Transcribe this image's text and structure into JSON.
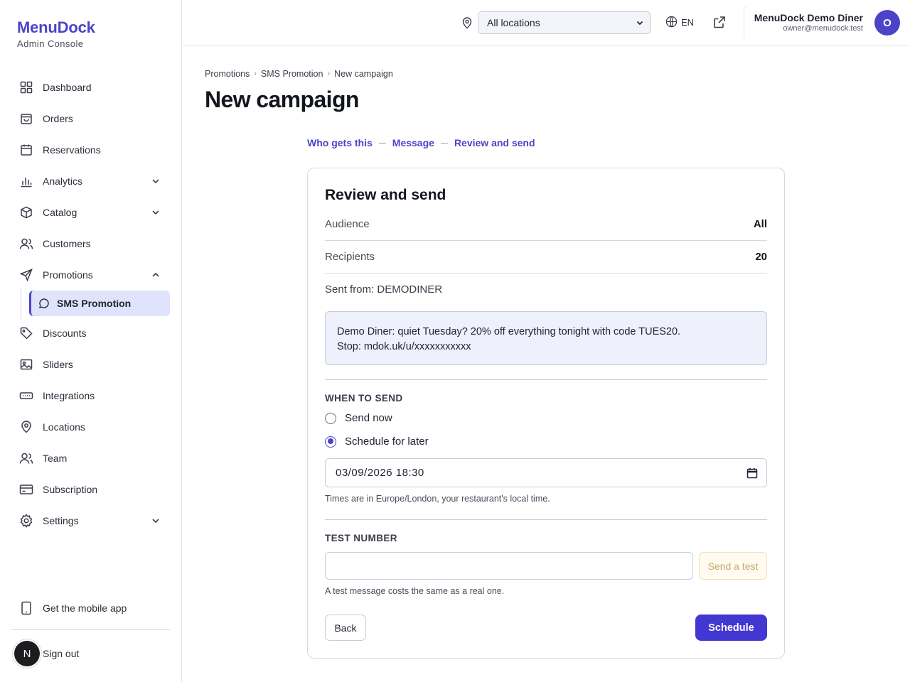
{
  "sidebar": {
    "brand_name": "MenuDock",
    "brand_sub": "Admin Console",
    "items": [
      {
        "label": "Dashboard",
        "icon": "grid-icon"
      },
      {
        "label": "Orders",
        "icon": "shopping-bag-icon"
      },
      {
        "label": "Reservations",
        "icon": "calendar-icon"
      },
      {
        "label": "Analytics",
        "icon": "bar-chart-icon",
        "expandable": true
      },
      {
        "label": "Catalog",
        "icon": "box-icon",
        "expandable": true
      },
      {
        "label": "Customers",
        "icon": "users-icon"
      },
      {
        "label": "Promotions",
        "icon": "send-icon",
        "expanded": true
      },
      {
        "label": "Discounts",
        "icon": "tag-icon"
      },
      {
        "label": "Sliders",
        "icon": "image-icon"
      },
      {
        "label": "Integrations",
        "icon": "plug-icon"
      },
      {
        "label": "Locations",
        "icon": "map-pin-icon"
      },
      {
        "label": "Team",
        "icon": "team-icon"
      },
      {
        "label": "Subscription",
        "icon": "credit-card-icon"
      },
      {
        "label": "Settings",
        "icon": "gear-icon",
        "expandable": true
      }
    ],
    "sub_item": {
      "label": "SMS Promotion",
      "icon": "message-circle-icon"
    },
    "mobile_app": "Get the mobile app",
    "sign_out": "Sign out",
    "badge_letter": "N"
  },
  "topbar": {
    "location_select": "All locations",
    "language": "EN",
    "user_name": "MenuDock Demo Diner",
    "user_email": "owner@menudock.test",
    "avatar_letter": "O"
  },
  "breadcrumb": [
    "Promotions",
    "SMS Promotion",
    "New campaign"
  ],
  "page_title": "New campaign",
  "steps": [
    "Who gets this",
    "Message",
    "Review and send"
  ],
  "card": {
    "title": "Review and send",
    "audience_label": "Audience",
    "audience_value": "All",
    "recipients_label": "Recipients",
    "recipients_value": "20",
    "sent_from": "Sent from: DEMODINER",
    "message_line1": "Demo Diner: quiet Tuesday? 20% off everything tonight with code TUES20.",
    "message_line2": "Stop: mdok.uk/u/xxxxxxxxxxx",
    "when_label": "WHEN TO SEND",
    "send_now": "Send now",
    "schedule_later": "Schedule for later",
    "datetime": "03/09/2026 18:30",
    "timezone_hint": "Times are in Europe/London, your restaurant's local time.",
    "test_label": "TEST NUMBER",
    "test_placeholder": "",
    "send_test": "Send a test",
    "test_hint": "A test message costs the same as a real one.",
    "back": "Back",
    "schedule": "Schedule"
  },
  "colors": {
    "accent": "#4b44c8",
    "primary_button": "#4337d1"
  }
}
